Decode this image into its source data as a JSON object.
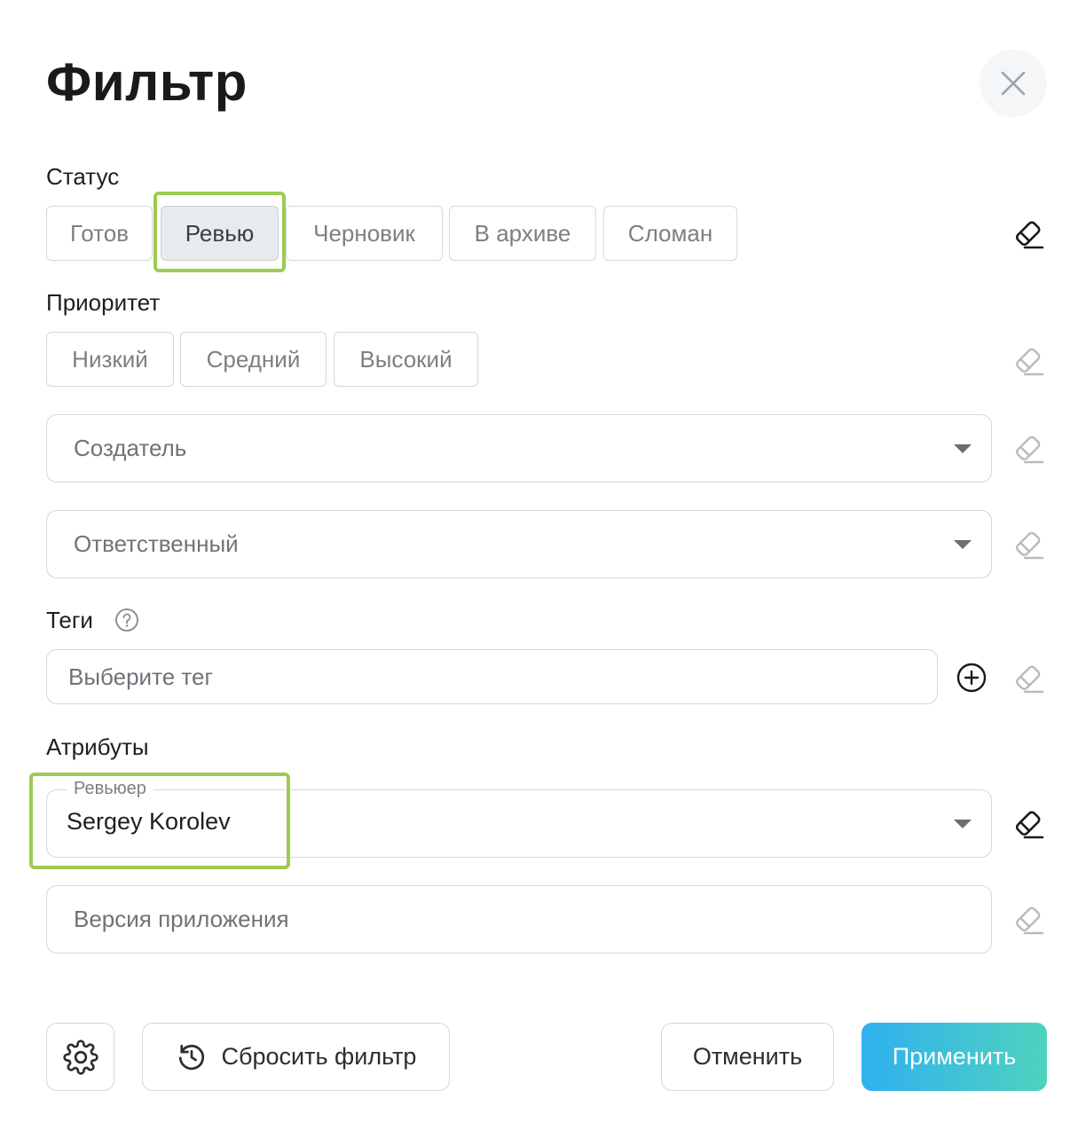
{
  "dialog": {
    "title": "Фильтр",
    "close_icon": "close-icon"
  },
  "status": {
    "label": "Статус",
    "options": [
      "Готов",
      "Ревью",
      "Черновик",
      "В архиве",
      "Сломан"
    ],
    "selected": "Ревью"
  },
  "priority": {
    "label": "Приоритет",
    "options": [
      "Низкий",
      "Средний",
      "Высокий"
    ]
  },
  "creator": {
    "placeholder": "Создатель"
  },
  "assignee": {
    "placeholder": "Ответственный"
  },
  "tags": {
    "label": "Теги",
    "help_icon": "help-circle-icon",
    "placeholder": "Выберите тег",
    "add_icon": "plus-circle-icon"
  },
  "attributes": {
    "label": "Атрибуты",
    "reviewer": {
      "label": "Ревьюер",
      "value": "Sergey Korolev"
    },
    "app_version": {
      "placeholder": "Версия приложения"
    }
  },
  "footer": {
    "settings_icon": "gear-icon",
    "reset_icon": "history-icon",
    "reset_label": "Сбросить фильтр",
    "cancel_label": "Отменить",
    "apply_label": "Применить"
  },
  "colors": {
    "highlight": "#9ccb52",
    "apply_gradient_start": "#2fb1ef",
    "apply_gradient_end": "#4fd2bf",
    "selected_chip_bg": "#e8ebee"
  }
}
